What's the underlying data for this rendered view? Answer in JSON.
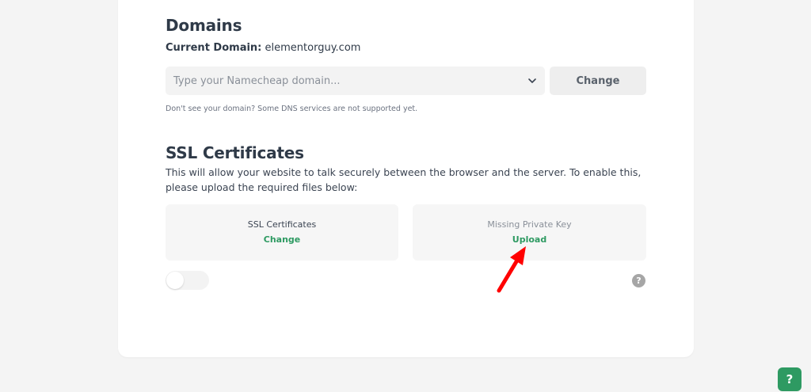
{
  "domains": {
    "title": "Domains",
    "current_domain_label": "Current Domain:",
    "current_domain_value": "elementorguy.com",
    "select_placeholder": "Type your Namecheap domain...",
    "change_label": "Change",
    "hint": "Don't see your domain? Some DNS services are not supported yet."
  },
  "ssl": {
    "title": "SSL Certificates",
    "description": "This will allow your website to talk securely between the browser and the server. To enable this, please upload the required files below:",
    "certificate_box": {
      "name": "SSL Certificates",
      "action": "Change"
    },
    "private_key_box": {
      "name": "Missing Private Key",
      "action": "Upload"
    },
    "toggle_on": false,
    "help_icon": "?"
  },
  "floating_help": {
    "label": "?"
  },
  "colors": {
    "accent_green": "#2e9a62",
    "annotation_arrow": "#ff0000"
  }
}
